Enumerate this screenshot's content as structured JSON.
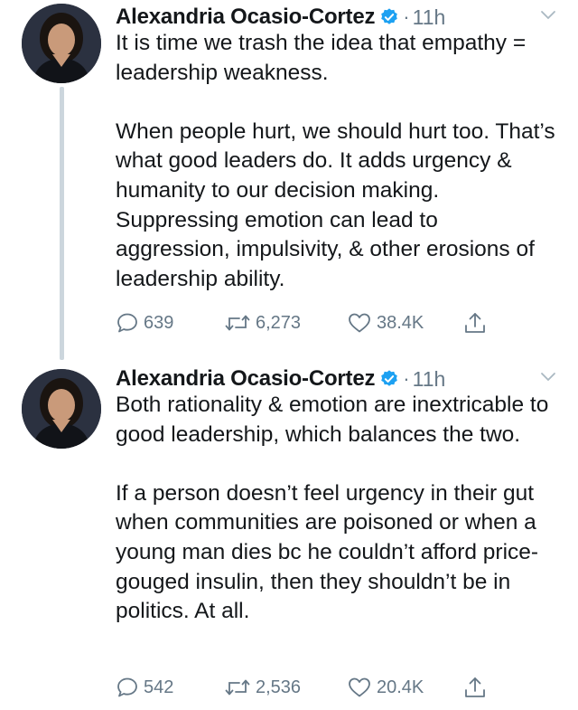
{
  "colors": {
    "text": "#14171a",
    "secondary": "#657786",
    "verified": "#1da1f2",
    "thread_line": "#ccd6dd"
  },
  "icons": {
    "reply": "speech-bubble-icon",
    "retweet": "retweet-icon",
    "like": "heart-icon",
    "share": "share-icon",
    "verified": "verified-badge-icon",
    "more": "chevron-down-icon"
  },
  "tweets": [
    {
      "author": "Alexandria Ocasio-Cortez",
      "dot": "·",
      "time": "11h",
      "paragraphs": [
        "It is time we trash the idea that empathy = leadership weakness.",
        "When people hurt, we should hurt too. That’s what good leaders do. It adds urgency & humanity to our decision making. Suppressing emotion can lead to aggression, impulsivity, & other erosions of leadership ability."
      ],
      "replies": "639",
      "retweets": "6,273",
      "likes": "38.4K"
    },
    {
      "author": "Alexandria Ocasio-Cortez",
      "dot": "·",
      "time": "11h",
      "paragraphs": [
        "Both rationality & emotion are inextricable to good leadership, which balances the two.",
        "If a person doesn’t feel urgency in their gut when communities are poisoned or when a young man dies bc he couldn’t afford price-gouged insulin, then they shouldn’t be in politics. At all."
      ],
      "replies": "542",
      "retweets": "2,536",
      "likes": "20.4K"
    }
  ]
}
